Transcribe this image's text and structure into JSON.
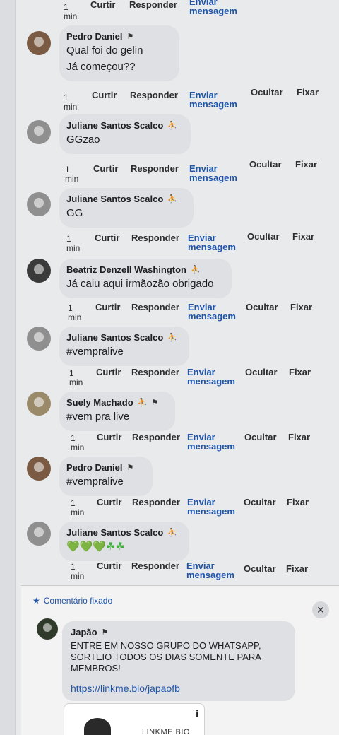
{
  "labels": {
    "time_value": "1",
    "time_unit": "min",
    "like": "Curtir",
    "reply": "Responder",
    "message": "Enviar mensagem",
    "hide": "Ocultar",
    "pin": "Fixar"
  },
  "comments": [
    {
      "author": "Pedro Daniel",
      "lines": [
        "Qual foi do gelin",
        "Já começou??"
      ]
    },
    {
      "author": "Juliane Santos Scalco",
      "lines": [
        "GGzao"
      ]
    },
    {
      "author": "Juliane Santos Scalco",
      "lines": [
        "GG"
      ]
    },
    {
      "author": "Beatriz Denzell Washington",
      "lines": [
        "Já caiu aqui irmãozão obrigado"
      ]
    },
    {
      "author": "Juliane Santos Scalco",
      "lines": [
        "#vempralive"
      ]
    },
    {
      "author": "Suely Machado",
      "lines": [
        "#vem pra live"
      ]
    },
    {
      "author": "Pedro Daniel",
      "lines": [
        "#vempralive"
      ]
    },
    {
      "author": "Juliane Santos Scalco",
      "lines": [
        "💚💚💚☘☘"
      ]
    }
  ],
  "pinned": {
    "label": "Comentário fixado",
    "author": "Japão",
    "text": "ENTRE EM NOSSO GRUPO DO WHATSAPP, SORTEIO TODOS OS DIAS SOMENTE PARA MEMBROS!",
    "link": "https://linkme.bio/japaofb",
    "card_title": "LINKME.BIO",
    "close_symbol": "✕",
    "info_symbol": "i"
  },
  "icons": {
    "flag": "⚑",
    "fan": "⛹",
    "pin": "📌"
  },
  "colors": {
    "link": "#1e55a8",
    "bubble": "#dfe0e3"
  }
}
